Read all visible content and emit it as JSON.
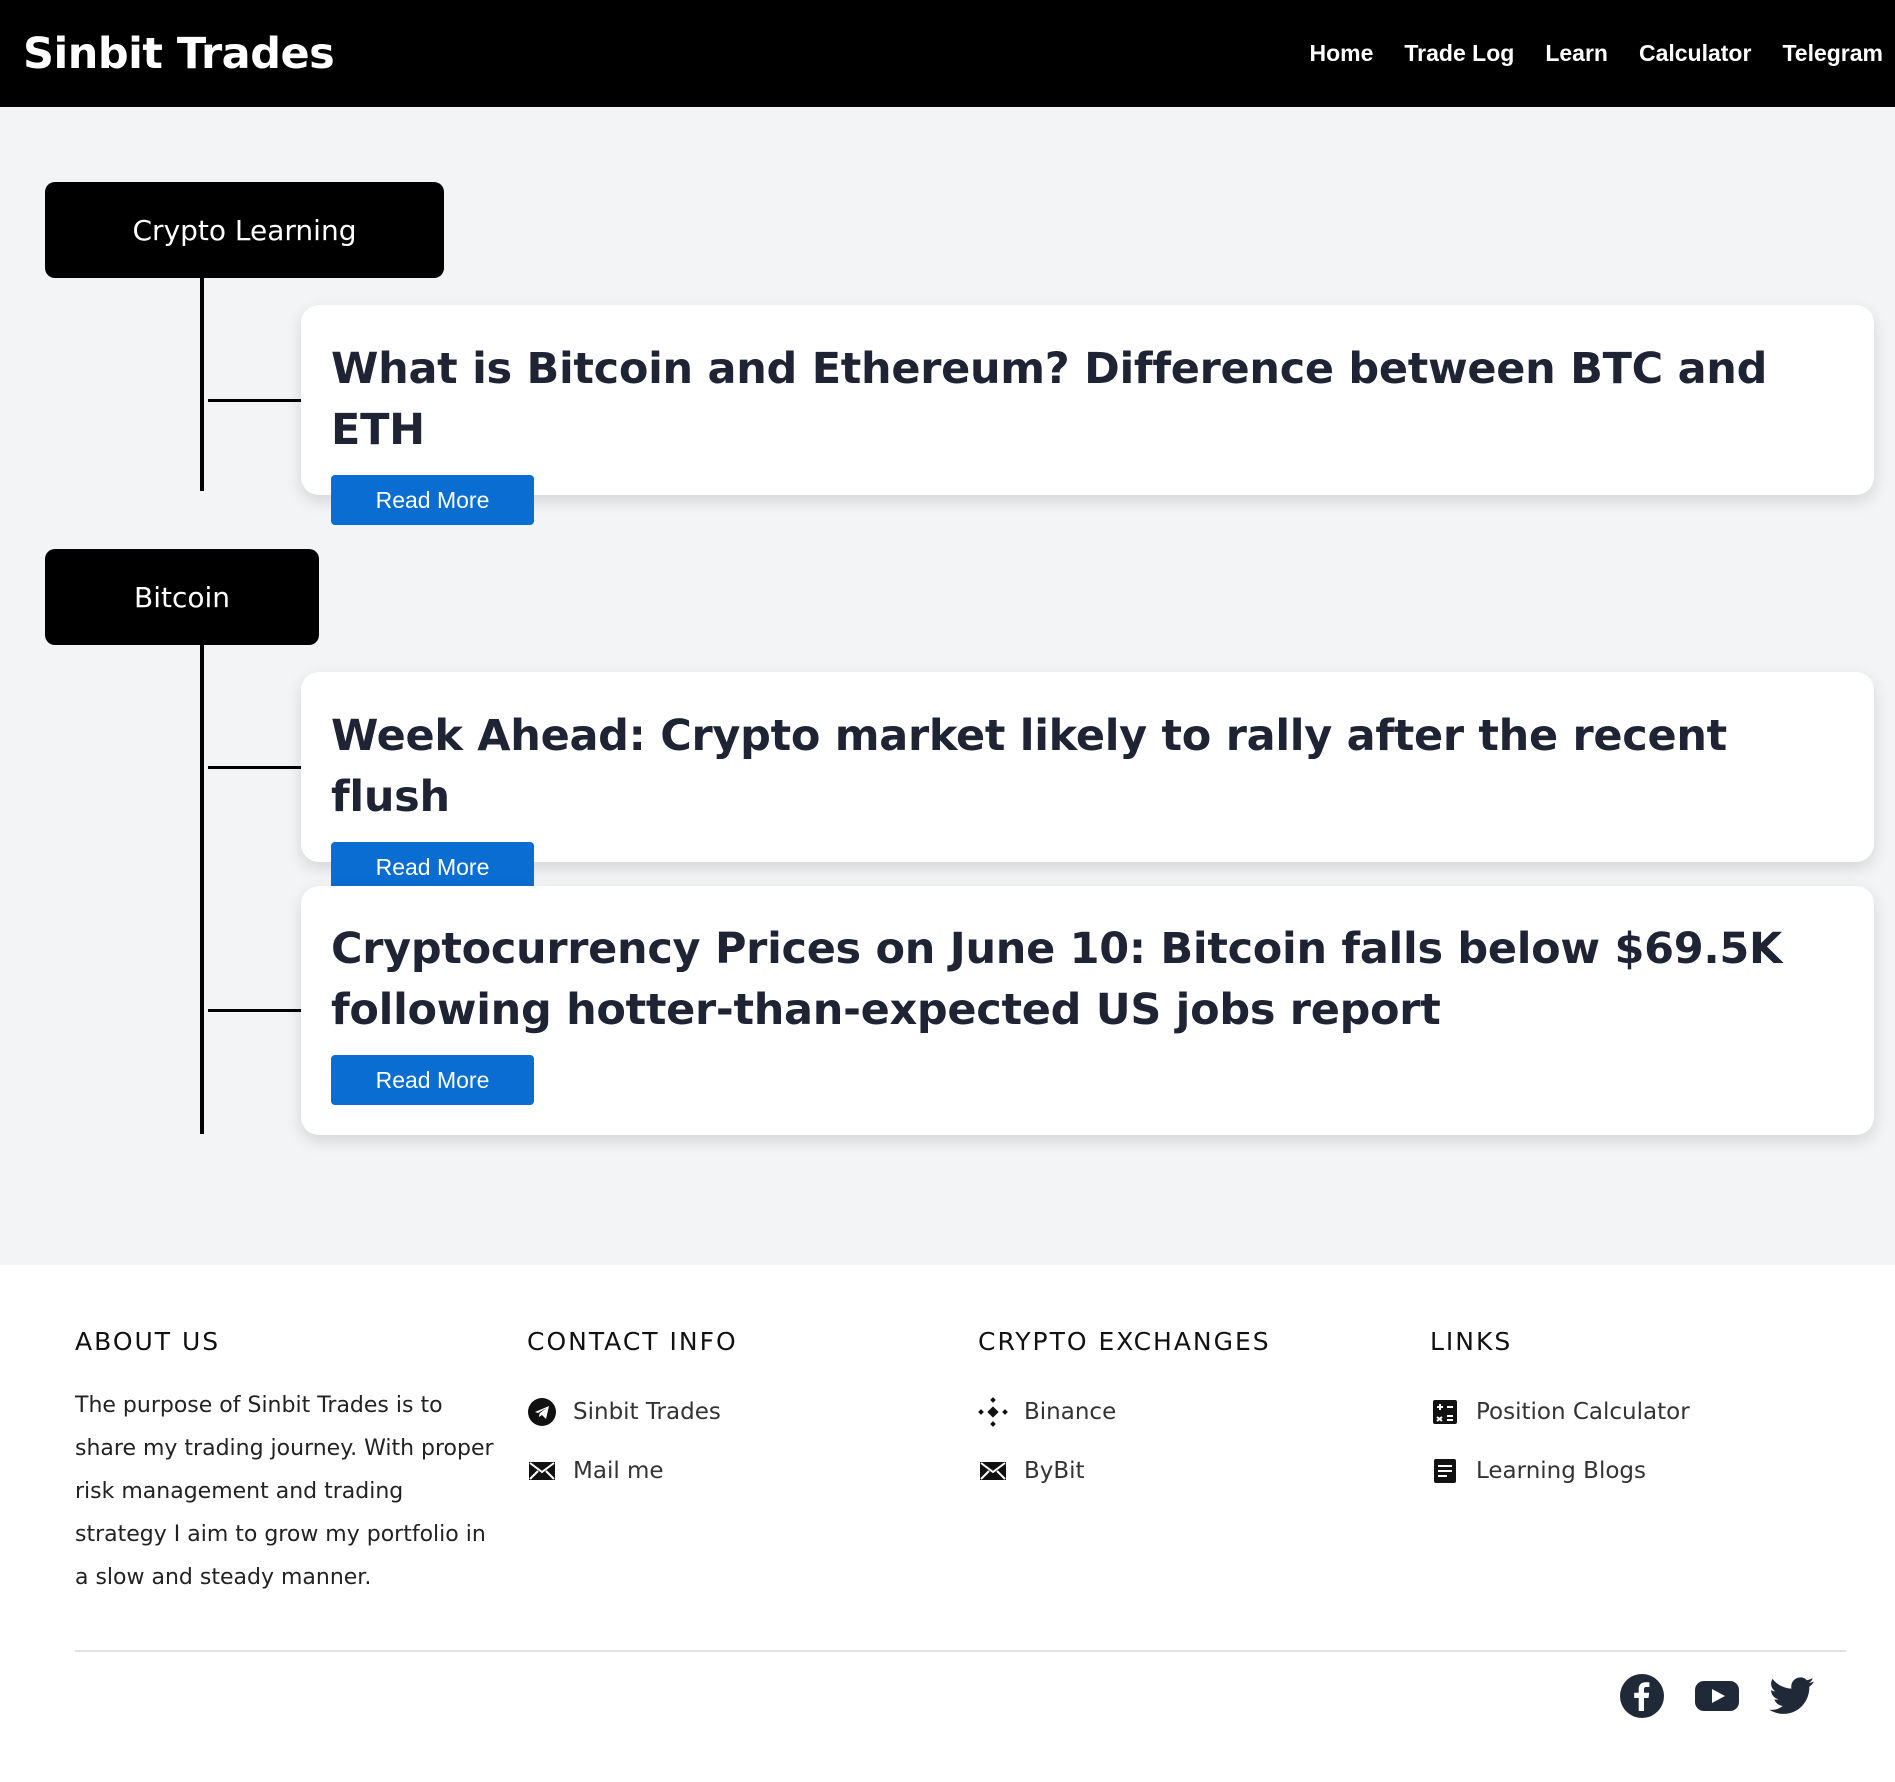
{
  "header": {
    "brand": "Sinbit Trades",
    "nav": [
      "Home",
      "Trade Log",
      "Learn",
      "Calculator",
      "Telegram"
    ]
  },
  "categories": [
    {
      "label": "Crypto Learning",
      "posts": [
        {
          "title": "What is Bitcoin and Ethereum? Difference between BTC and ETH",
          "button": "Read More"
        }
      ]
    },
    {
      "label": "Bitcoin",
      "posts": [
        {
          "title": "Week Ahead: Crypto market likely to rally after the recent flush",
          "button": "Read More"
        },
        {
          "title": "Cryptocurrency Prices on June 10: Bitcoin falls below $69.5K following hotter-than-expected US jobs report",
          "button": "Read More"
        }
      ]
    }
  ],
  "footer": {
    "about": {
      "heading": "ABOUT US",
      "text": "The purpose of Sinbit Trades is to share my trading journey. With proper risk management and trading strategy I aim to grow my portfolio in a slow and steady manner."
    },
    "contact": {
      "heading": "CONTACT INFO",
      "items": [
        {
          "label": "Sinbit Trades",
          "icon": "telegram-icon"
        },
        {
          "label": "Mail me",
          "icon": "mail-icon"
        }
      ]
    },
    "exchanges": {
      "heading": "CRYPTO EXCHANGES",
      "items": [
        {
          "label": "Binance",
          "icon": "binance-icon"
        },
        {
          "label": "ByBit",
          "icon": "mail-icon"
        }
      ]
    },
    "links": {
      "heading": "LINKS",
      "items": [
        {
          "label": "Position Calculator",
          "icon": "calculator-icon"
        },
        {
          "label": "Learning Blogs",
          "icon": "document-icon"
        }
      ]
    },
    "social": [
      "facebook-icon",
      "youtube-icon",
      "twitter-icon"
    ]
  },
  "colors": {
    "header_bg": "#000000",
    "page_bg": "#f3f4f6",
    "button_blue": "#0a6dd1",
    "title_text": "#1e2434"
  }
}
